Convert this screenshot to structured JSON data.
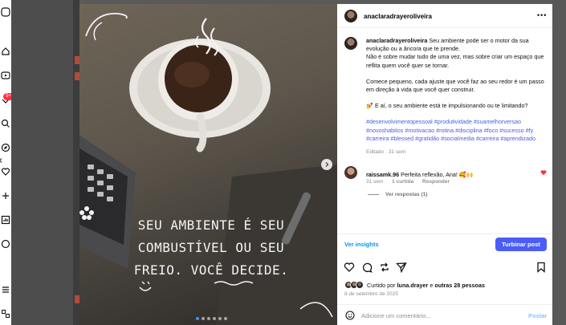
{
  "nav": {
    "notification_count": "9+"
  },
  "post_image": {
    "text_lines": [
      "SEU AMBIENTE É SEU",
      "COMBUSTÍVEL OU SEU",
      "FREIO. VOCÊ DECIDE."
    ],
    "slide_count": 6,
    "active_slide": 1
  },
  "header": {
    "username": "anaclaradrayeroliveira",
    "more_icon": "more-horizontal-icon"
  },
  "caption": {
    "username": "anaclaradrayeroliveira",
    "line1": "Seu ambiente pode ser o motor da sua evolução ou a âncora que te prende.",
    "line2": "Não é sobre mudar tudo de uma vez, mas sobre criar um espaço que reflita quem você quer se tornar.",
    "para2": "Comece pequeno, cada ajuste que você faz ao seu redor é um passo em direção à vida que você quer construir.",
    "para3": "💅 E aí, o seu ambiente está te impulsionando ou te limitando?",
    "hashtags": "#desenvolvimentopessoal #produtividade #suamelhorversao #novoshabitos #motivacao #rotina #disciplina #foco #sucesso #fy #carreira #blessed #gratidão #socialmedia #carreira #aprendizado",
    "meta": "Editado · 31 sem"
  },
  "comment": {
    "username": "raissamk.96",
    "text": "Perfeita reflexão, Ana! 🥰🙌",
    "time": "31 sem",
    "likes": "1 curtida",
    "reply": "Responder",
    "view_replies": "Ver respostas (1)"
  },
  "insights": {
    "view_label": "Ver insights",
    "boost_label": "Turbinar post"
  },
  "likes": {
    "prefix": "Curtido por",
    "user": "luna.drayer",
    "and": "e",
    "others": "outras 28 pessoas"
  },
  "date": "8 de setembro de 2025",
  "add_comment": {
    "placeholder": "Adicione um comentário...",
    "post_label": "Postar"
  },
  "colors": {
    "accent": "#0095f6",
    "boost": "#4a5df9",
    "hashtag": "#4a5de0",
    "like_red": "#ff3040"
  }
}
